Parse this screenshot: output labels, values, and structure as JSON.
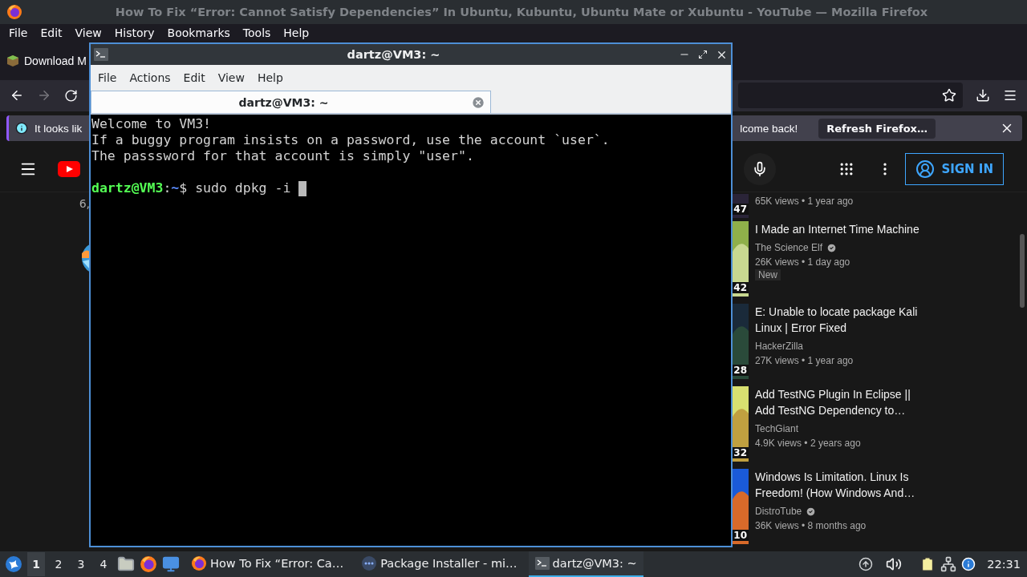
{
  "browser": {
    "title": "How To Fix “Error: Cannot Satisfy Dependencies” In Ubuntu, Kubuntu, Ubuntu Mate or Xubuntu - YouTube — Mozilla Firefox",
    "menu": [
      "File",
      "Edit",
      "View",
      "History",
      "Bookmarks",
      "Tools",
      "Help"
    ],
    "bookmark": "Download M",
    "notification": {
      "text_start": "It looks lik",
      "text_end": "lcome back!",
      "button": "Refresh Firefox…"
    }
  },
  "youtube": {
    "sign_in": "SIGN IN",
    "left_text": "6,",
    "partial_video": {
      "meta": "65K views • 1 year ago",
      "duration": "47"
    },
    "videos": [
      {
        "title": "I Made an Internet Time Machine",
        "channel": "The Science Elf",
        "verified": true,
        "meta": "26K views • 1 day ago",
        "badge": "New",
        "duration": "42"
      },
      {
        "title": "E: Unable to locate package Kali Linux | Error Fixed",
        "channel": "HackerZilla",
        "verified": false,
        "meta": "27K views • 1 year ago",
        "duration": "28"
      },
      {
        "title": "Add TestNG Plugin In Eclipse || Add TestNG Dependency to…",
        "channel": "TechGiant",
        "verified": false,
        "meta": "4.9K views • 2 years ago",
        "duration": "32"
      },
      {
        "title": "Windows Is Limitation. Linux Is Freedom! (How Windows And…",
        "channel": "DistroTube",
        "verified": true,
        "meta": "36K views • 8 months ago",
        "duration": "10"
      }
    ]
  },
  "terminal": {
    "title": "dartz@VM3: ~",
    "menu": [
      "File",
      "Actions",
      "Edit",
      "View",
      "Help"
    ],
    "tab": "dartz@VM3: ~",
    "lines": [
      "Welcome to VM3!",
      "If a buggy program insists on a password, use the account `user`.",
      "The passsword for that account is simply \"user\"."
    ],
    "prompt": {
      "user_host": "dartz@VM3",
      "separator": ":",
      "path": "~",
      "symbol": "$",
      "command": "sudo dpkg -i"
    }
  },
  "taskbar": {
    "workspaces": [
      {
        "label": "1",
        "selected": true
      },
      {
        "label": "2",
        "selected": false
      },
      {
        "label": "3",
        "selected": false
      },
      {
        "label": "4",
        "selected": false
      }
    ],
    "tasks": [
      {
        "kind": "firefox",
        "label": "How To Fix “Error: Ca…",
        "selected": false
      },
      {
        "kind": "installer",
        "label": "Package Installer - mi…",
        "selected": false
      },
      {
        "kind": "terminal",
        "label": "dartz@VM3: ~",
        "selected": true
      }
    ],
    "clock": "22:31"
  }
}
